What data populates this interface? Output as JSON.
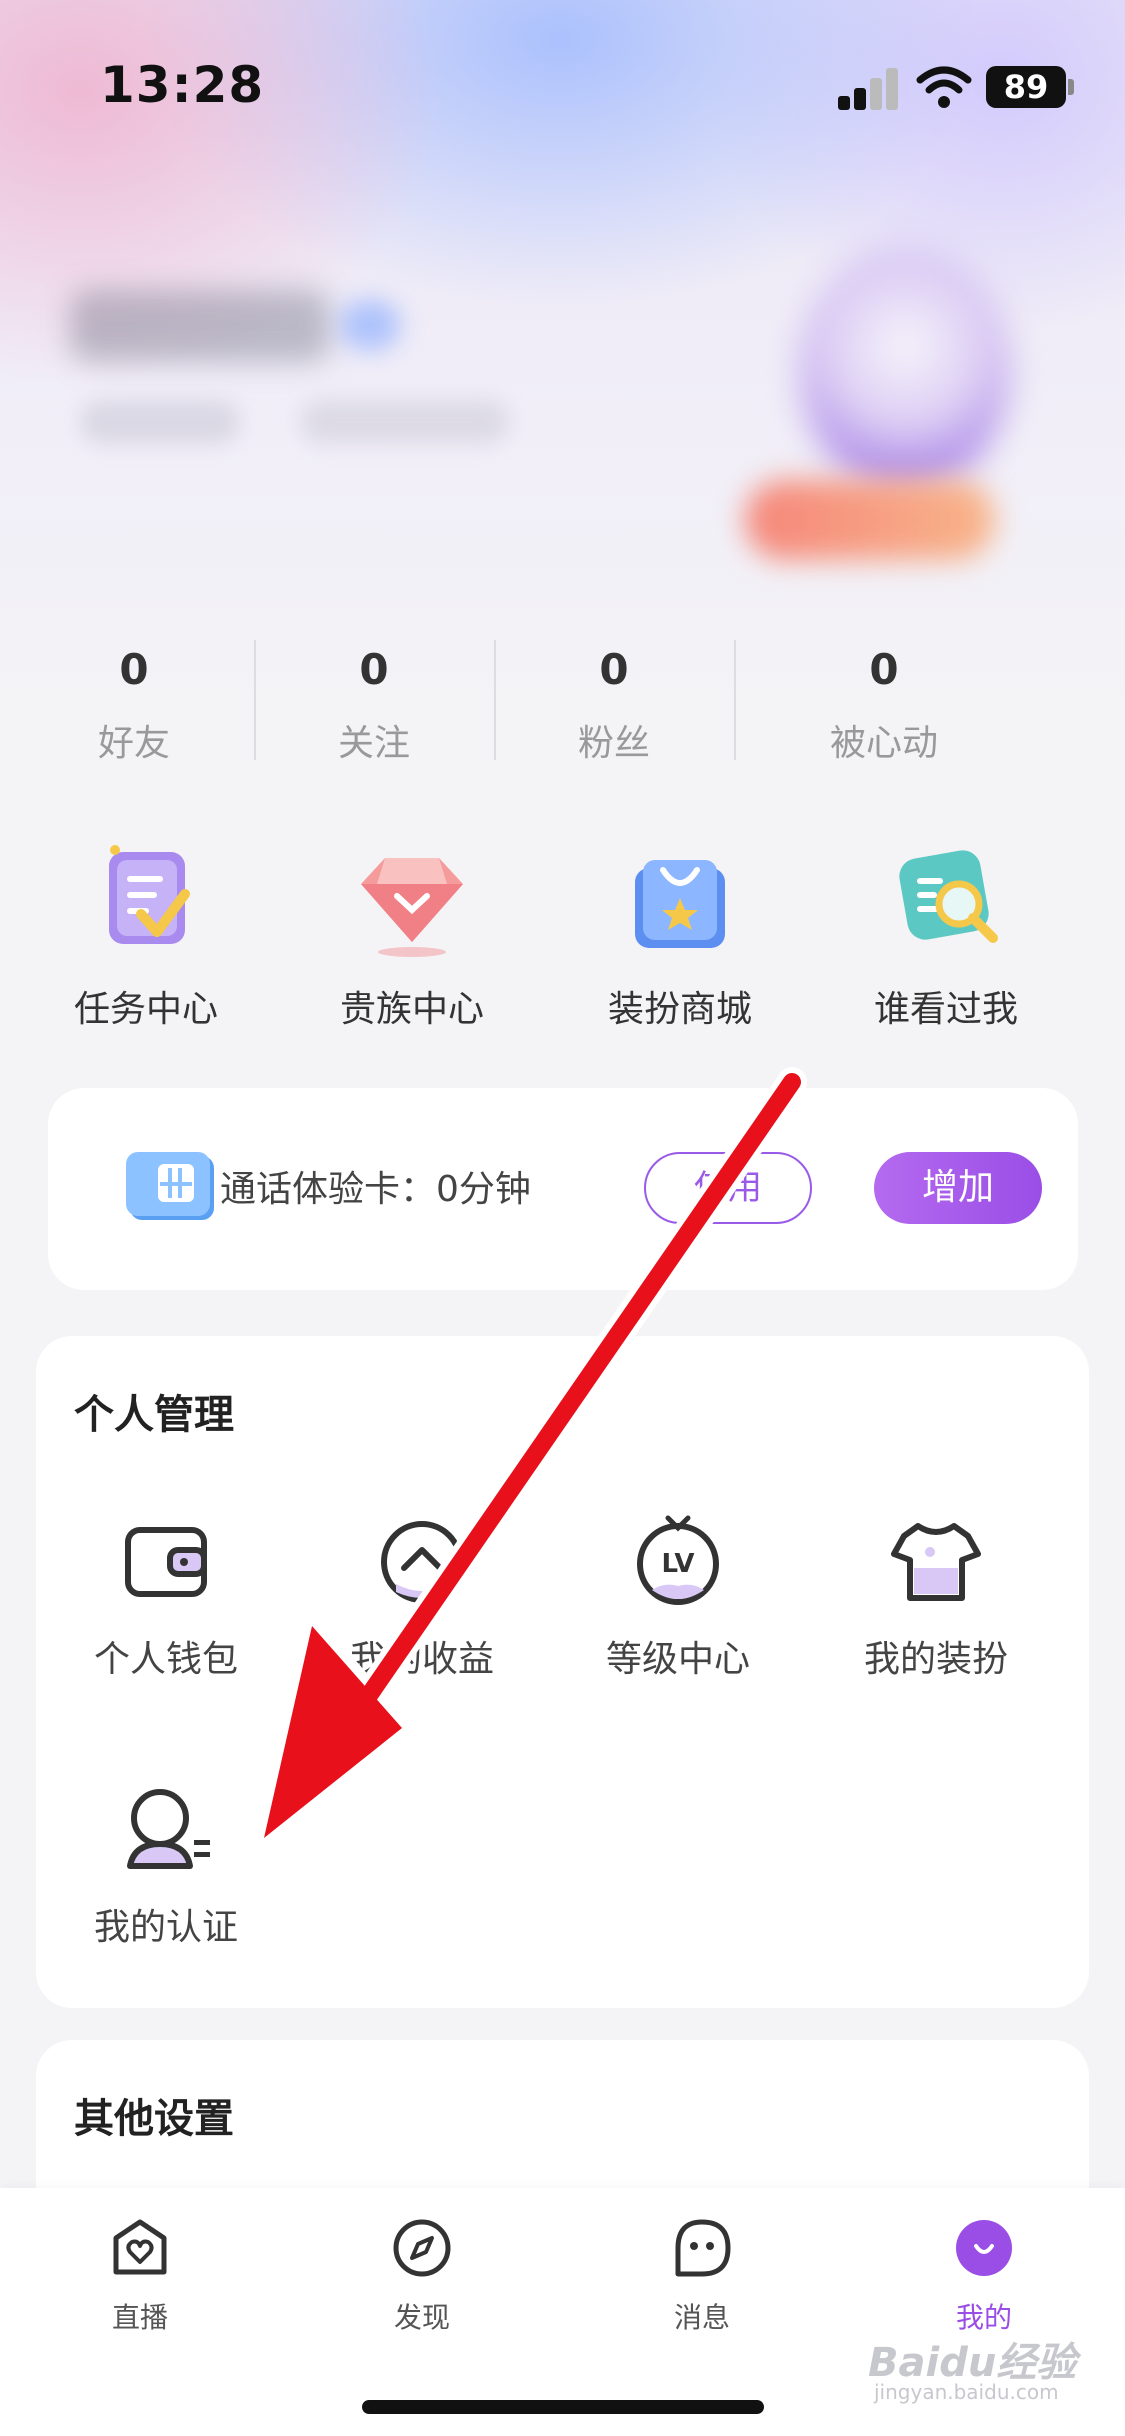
{
  "status_bar": {
    "time": "13:28",
    "battery": "89"
  },
  "stats": [
    {
      "value": "0",
      "label": "好友"
    },
    {
      "value": "0",
      "label": "关注"
    },
    {
      "value": "0",
      "label": "粉丝"
    },
    {
      "value": "0",
      "label": "被心动"
    }
  ],
  "quick_entries": [
    {
      "label": "任务中心",
      "icon": "task-icon"
    },
    {
      "label": "贵族中心",
      "icon": "diamond-icon"
    },
    {
      "label": "装扮商城",
      "icon": "shopping-bag-icon"
    },
    {
      "label": "谁看过我",
      "icon": "magnifier-icon"
    }
  ],
  "call_card": {
    "text": "通话体验卡：0分钟",
    "use_label": "使用",
    "add_label": "增加"
  },
  "personal_management": {
    "title": "个人管理",
    "items": [
      {
        "label": "个人钱包",
        "icon": "wallet-icon"
      },
      {
        "label": "我的收益",
        "icon": "earnings-icon"
      },
      {
        "label": "等级中心",
        "icon": "level-icon"
      },
      {
        "label": "我的装扮",
        "icon": "outfit-icon"
      },
      {
        "label": "我的认证",
        "icon": "verification-icon"
      }
    ]
  },
  "other_settings": {
    "title": "其他设置"
  },
  "tab_bar": {
    "tabs": [
      {
        "label": "直播",
        "icon": "live-icon",
        "active": false
      },
      {
        "label": "发现",
        "icon": "compass-icon",
        "active": false
      },
      {
        "label": "消息",
        "icon": "message-icon",
        "active": false
      },
      {
        "label": "我的",
        "icon": "me-icon",
        "active": true
      }
    ]
  },
  "watermark": {
    "brand": "Baidu经验",
    "domain": "jingyan.baidu.com"
  },
  "colors": {
    "accent": "#9a4ee6",
    "arrow": "#e8101a"
  }
}
